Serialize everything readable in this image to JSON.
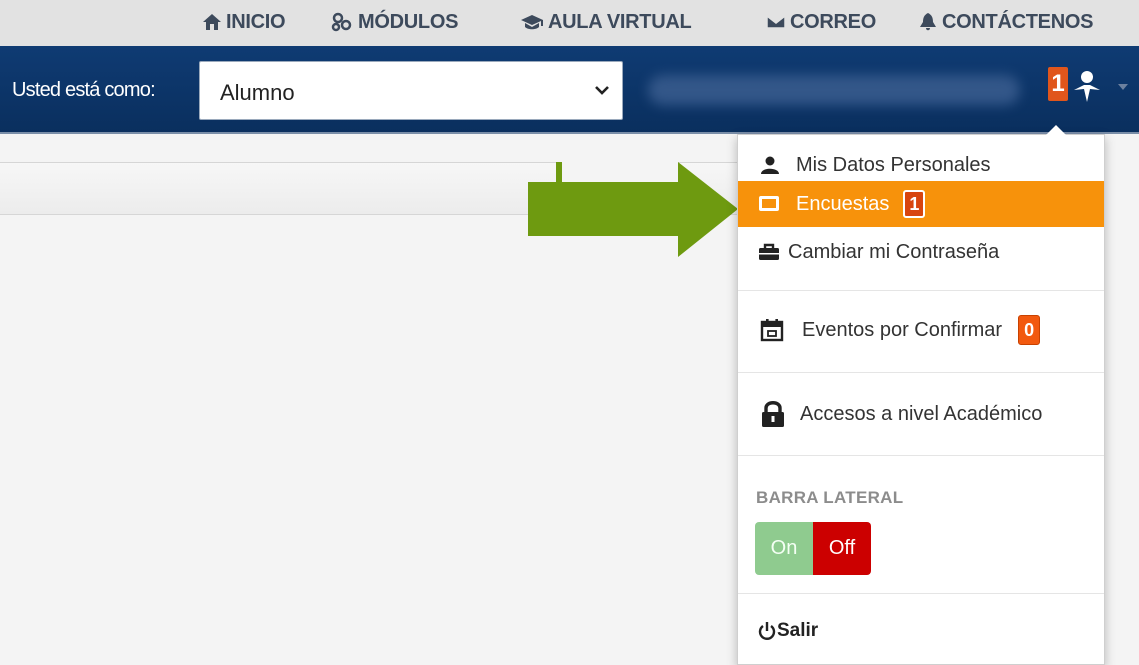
{
  "topnav": {
    "items": [
      {
        "label": "INICIO",
        "icon": "home-icon"
      },
      {
        "label": "MÓDULOS",
        "icon": "modules-icon"
      },
      {
        "label": "AULA VIRTUAL",
        "icon": "graduation-cap-icon"
      },
      {
        "label": "CORREO",
        "icon": "envelope-icon"
      },
      {
        "label": "CONTÁCTENOS",
        "icon": "bell-icon"
      }
    ]
  },
  "header": {
    "role_label": "Usted está como:",
    "role_value": "Alumno",
    "notification_count": "1"
  },
  "menu": {
    "items": [
      {
        "label": "Mis Datos Personales",
        "icon": "user-icon"
      },
      {
        "label": "Encuestas",
        "icon": "survey-icon",
        "badge": "1",
        "active": true
      },
      {
        "label": "Cambiar mi Contraseña",
        "icon": "briefcase-icon"
      },
      {
        "label": "Eventos por Confirmar",
        "icon": "calendar-icon",
        "badge": "0"
      },
      {
        "label": "Accesos a nivel Académico",
        "icon": "lock-icon"
      }
    ],
    "sidebar_section": "BARRA LATERAL",
    "toggle_on": "On",
    "toggle_off": "Off",
    "logout": "Salir"
  },
  "colors": {
    "navy": "#0f3b73",
    "active_item": "#f7920b",
    "badge": "#d8450f",
    "toggle_on": "#8fcb8f",
    "toggle_off": "#cc0000",
    "arrow": "#6e9a10"
  }
}
